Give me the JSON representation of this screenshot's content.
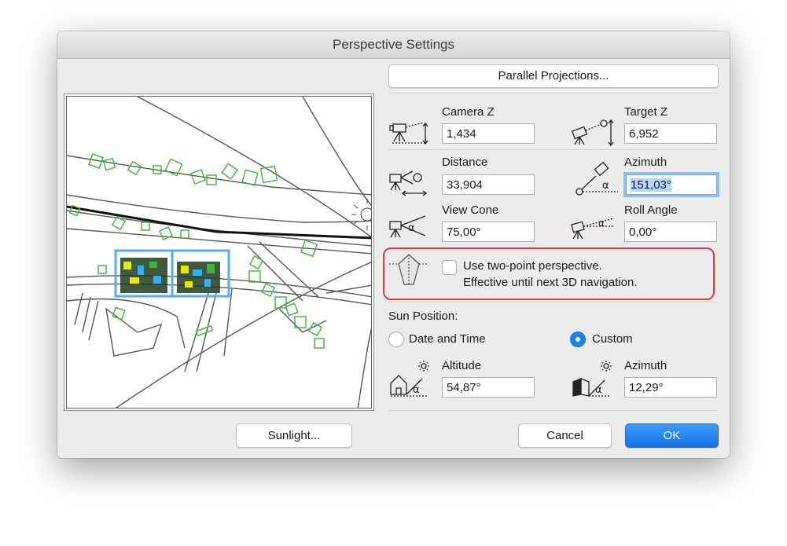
{
  "window": {
    "title": "Perspective Settings"
  },
  "buttons": {
    "parallel_projections": "Parallel Projections...",
    "sunlight": "Sunlight...",
    "cancel": "Cancel",
    "ok": "OK"
  },
  "camera": {
    "camera_z_label": "Camera Z",
    "camera_z_value": "1,434",
    "target_z_label": "Target Z",
    "target_z_value": "6,952",
    "distance_label": "Distance",
    "distance_value": "33,904",
    "azimuth_label": "Azimuth",
    "azimuth_value": "151,03°",
    "view_cone_label": "View Cone",
    "view_cone_value": "75,00°",
    "roll_angle_label": "Roll Angle",
    "roll_angle_value": "0,00°"
  },
  "two_point": {
    "checked": false,
    "line1": "Use two-point perspective.",
    "line2": "Effective until next 3D navigation."
  },
  "sun": {
    "heading": "Sun Position:",
    "date_time_label": "Date and Time",
    "custom_label": "Custom",
    "selected": "Custom",
    "altitude_label": "Altitude",
    "altitude_value": "54,87°",
    "azimuth_label": "Azimuth",
    "azimuth_value": "12,29°"
  },
  "colors": {
    "accent": "#1a82f3",
    "highlight_box": "#e03a3a",
    "plan_green": "#3cb43c",
    "plan_selection": "#5aaaf0"
  }
}
